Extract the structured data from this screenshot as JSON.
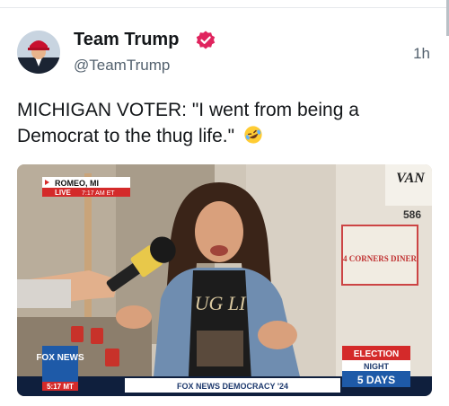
{
  "post": {
    "author_name": "Team Trump",
    "author_handle": "@TeamTrump",
    "timestamp": "1h",
    "text": "MICHIGAN VOTER: \"I went from being a Democrat to the thug life.\"",
    "emoji": "rolling-on-floor-laughing-emoji"
  },
  "media": {
    "location": "ROMEO, MI",
    "live_label": "LIVE",
    "live_time": "7:17 AM ET",
    "sign_text": "4 CORNERS DINER",
    "wall_number": "586",
    "van_text": "VAN",
    "shirt_text": "UG LI",
    "network": "FOX NEWS",
    "clock": "5:17 MT",
    "ticker": "FOX NEWS DEMOCRACY '24",
    "election_label": "ELECTION",
    "night_label": "NIGHT",
    "countdown": "5 DAYS",
    "colors": {
      "fox_blue": "#1e5aa8",
      "fox_red": "#d42a2a",
      "verified_red": "#e0245e"
    }
  }
}
